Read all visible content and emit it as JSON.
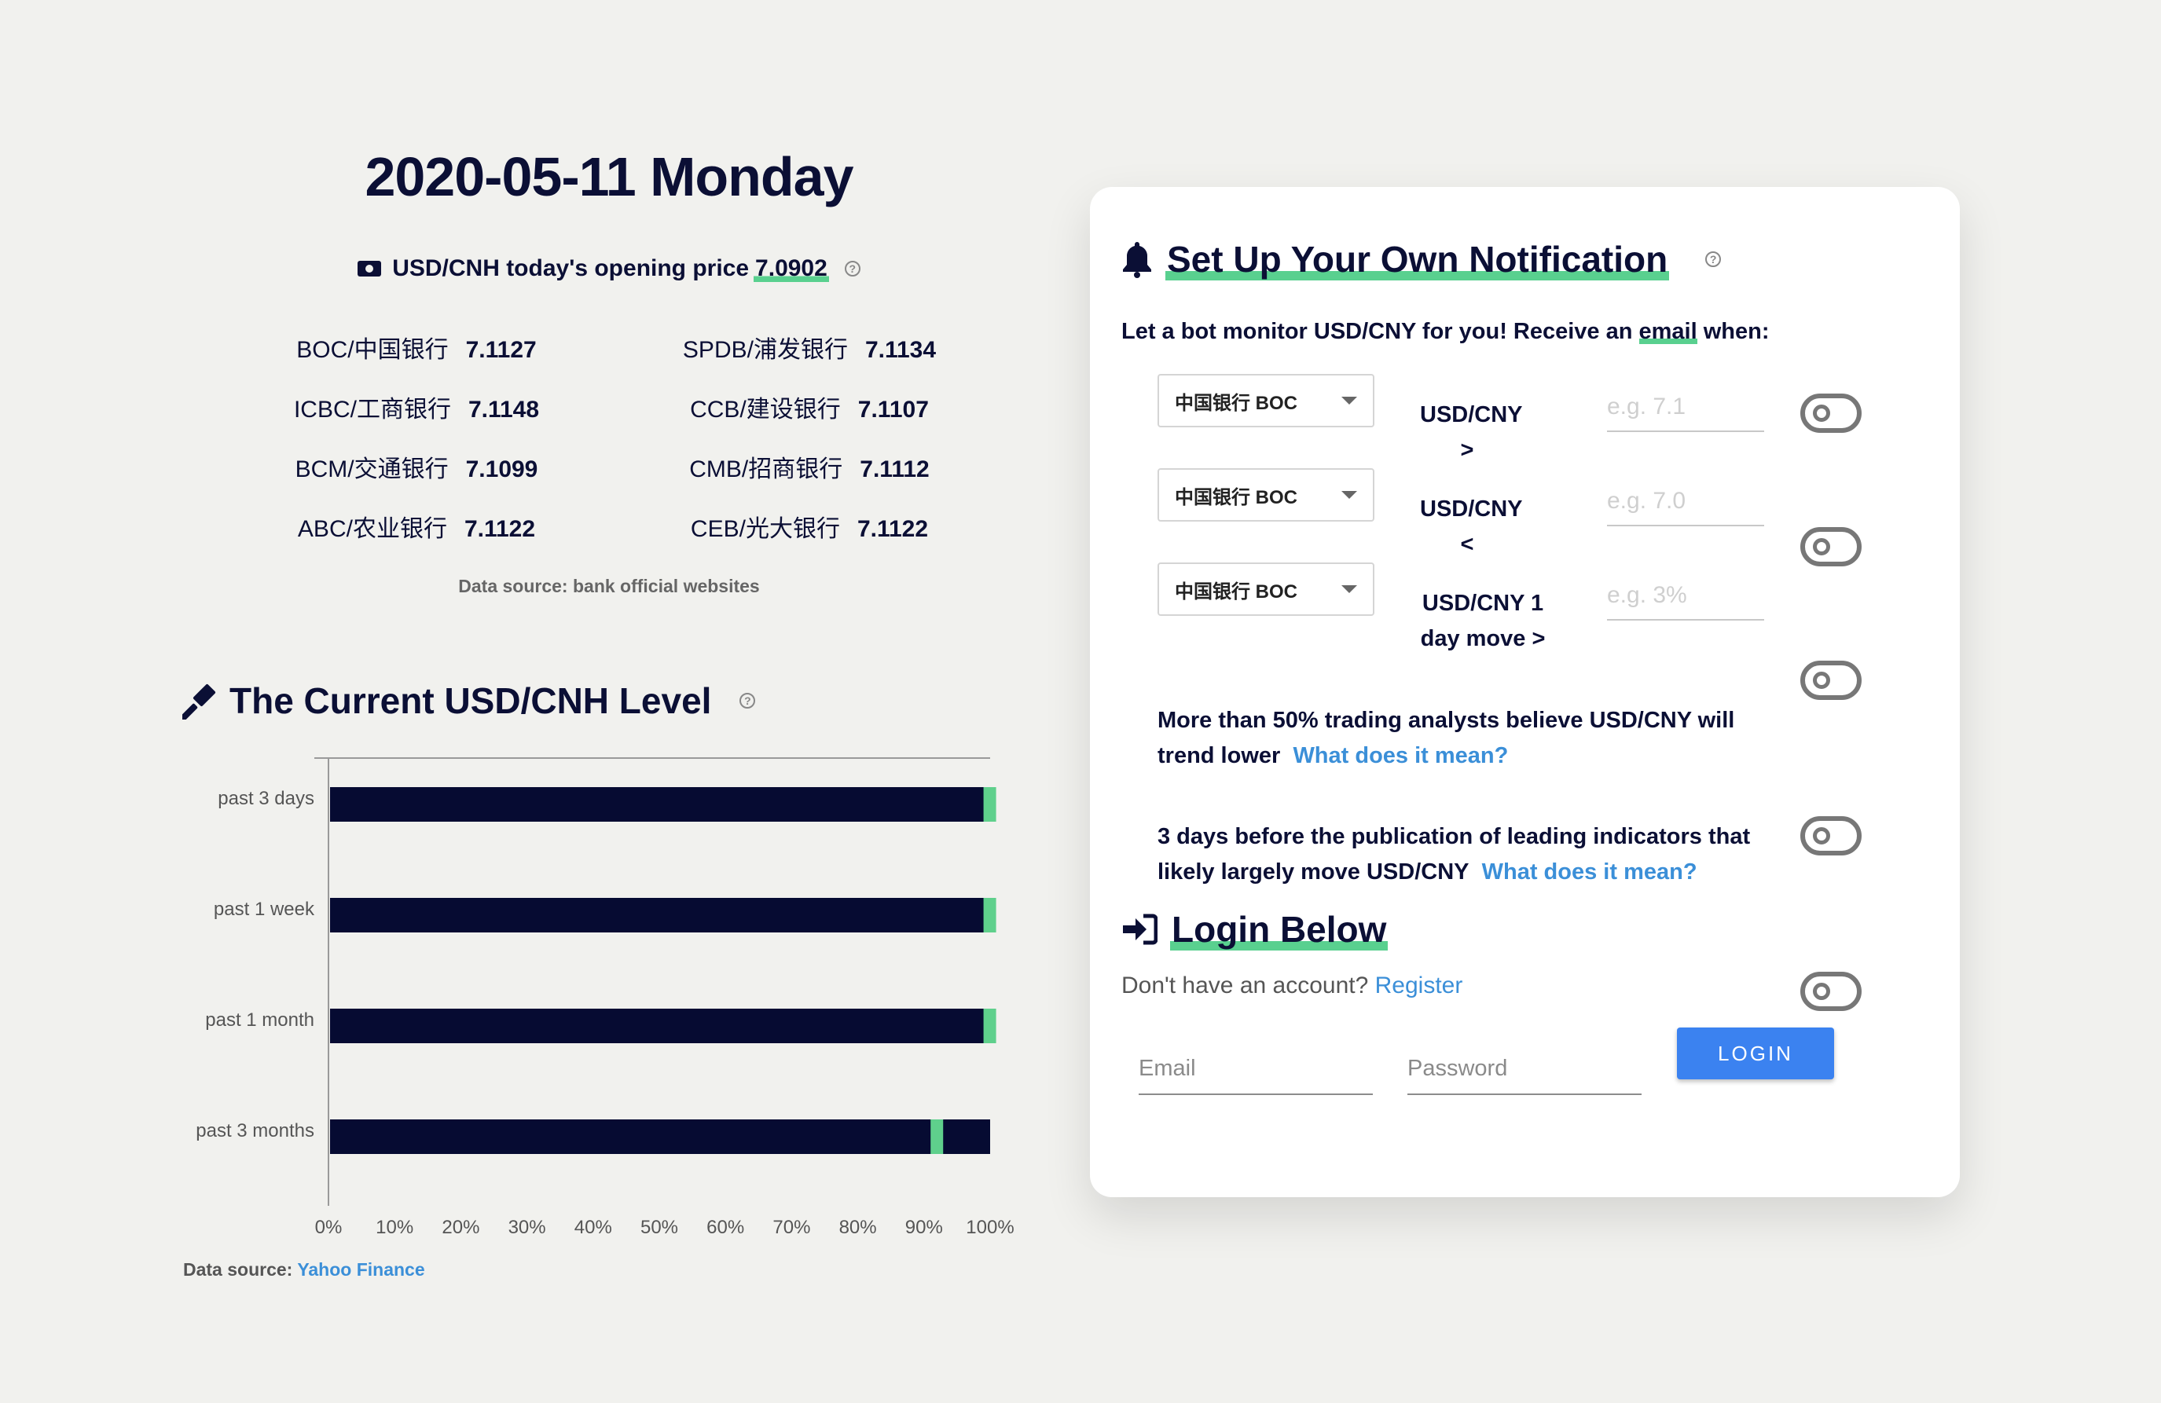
{
  "header": {
    "date": "2020-05-11 Monday",
    "opening_label": "USD/CNH today's opening price",
    "opening_price": "7.0902",
    "help": "?"
  },
  "bank_rates": [
    {
      "bank": "BOC/中国银行",
      "rate": "7.1127"
    },
    {
      "bank": "SPDB/浦发银行",
      "rate": "7.1134"
    },
    {
      "bank": "ICBC/工商银行",
      "rate": "7.1148"
    },
    {
      "bank": "CCB/建设银行",
      "rate": "7.1107"
    },
    {
      "bank": "BCM/交通银行",
      "rate": "7.1099"
    },
    {
      "bank": "CMB/招商银行",
      "rate": "7.1112"
    },
    {
      "bank": "ABC/农业银行",
      "rate": "7.1122"
    },
    {
      "bank": "CEB/光大银行",
      "rate": "7.1122"
    }
  ],
  "bank_source": "Data source: bank official websites",
  "level_section": {
    "title": "The Current USD/CNH Level",
    "help": "?",
    "source_prefix": "Data source: ",
    "source_link": "Yahoo Finance"
  },
  "chart_data": {
    "type": "bar",
    "orientation": "horizontal",
    "categories": [
      "past 3 days",
      "past 1 week",
      "past 1 month",
      "past 3 months"
    ],
    "marker_percent": [
      99,
      99,
      99,
      91
    ],
    "xlim": [
      0,
      100
    ],
    "xticks": [
      "0%",
      "10%",
      "20%",
      "30%",
      "40%",
      "50%",
      "60%",
      "70%",
      "80%",
      "90%",
      "100%"
    ],
    "colors": {
      "bar": "#060b32",
      "marker": "#5fd08c",
      "axis": "#9a9a9a"
    }
  },
  "notification": {
    "title": "Set Up Your Own Notification",
    "help": "?",
    "subtitle_before": "Let a bot monitor USD/CNY for you! Receive an ",
    "subtitle_email": "email",
    "subtitle_after": " when:",
    "rules": [
      {
        "bank": "中国银行 BOC",
        "condition": "USD/CNY >",
        "placeholder": "e.g. 7.1"
      },
      {
        "bank": "中国银行 BOC",
        "condition": "USD/CNY <",
        "placeholder": "e.g. 7.0"
      },
      {
        "bank": "中国银行 BOC",
        "condition_line1": "USD/CNY 1",
        "condition_line2": "day move >",
        "placeholder": "e.g. 3%"
      }
    ],
    "analyst_rule": {
      "text": "More than 50% trading analysts believe USD/CNY will trend lower",
      "link": "What does it mean?"
    },
    "indicator_rule": {
      "text": "3 days before the publication of leading indicators that likely largely move USD/CNY",
      "link": "What does it mean?"
    }
  },
  "login": {
    "title": "Login Below",
    "no_account": "Don't have an account?",
    "register": "Register",
    "email_placeholder": "Email",
    "password_placeholder": "Password",
    "button": "LOGIN"
  },
  "colors": {
    "navy": "#0b0f35",
    "green": "#59d08f",
    "blue": "#3b82f0",
    "link": "#3b8fd8"
  }
}
